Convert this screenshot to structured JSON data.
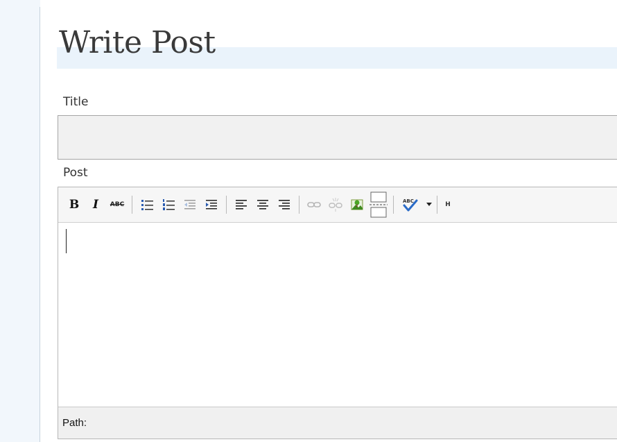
{
  "page": {
    "title": "Write Post"
  },
  "form": {
    "title_label": "Title",
    "title_value": "",
    "post_label": "Post"
  },
  "editor": {
    "toolbar": {
      "bold_label": "B",
      "italic_label": "I",
      "strike_label": "ABC",
      "spellcheck_label": "ABC",
      "html_label": "H"
    },
    "content": "",
    "path_label": "Path:"
  },
  "colors": {
    "sidebar_bg": "#f2f7fc",
    "title_band": "#eaf3fb",
    "input_bg": "#f1f1f1",
    "toolbar_bg": "#f6f6f6",
    "path_bg": "#f0f0f0"
  }
}
